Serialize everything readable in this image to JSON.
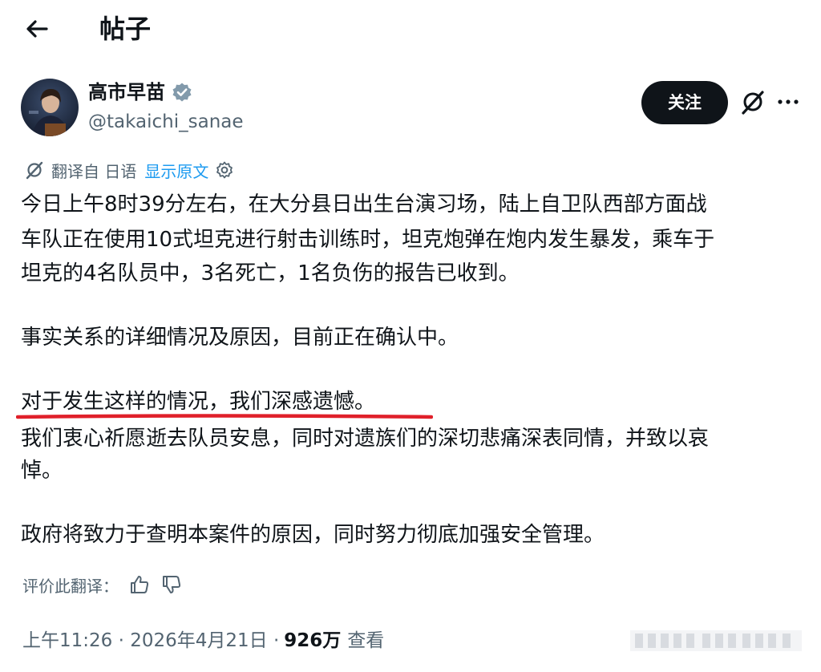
{
  "header": {
    "title": "帖子"
  },
  "author": {
    "display_name": "高市早苗",
    "handle": "@takaichi_sanae"
  },
  "actions": {
    "follow_label": "关注"
  },
  "translation": {
    "translated_from": "翻译自 日语",
    "show_original": "显示原文"
  },
  "post": {
    "lines": [
      "今日上午8时39分左右，在大分县日出生台演习场，陆上自卫队西部方面战",
      "车队正在使用10式坦克进行射击训练时，坦克炮弹在炮内发生暴发，乘车于",
      "坦克的4名队员中，3名死亡，1名负伤的报告已收到。",
      "事实关系的详细情况及原因，目前正在确认中。",
      "对于发生这样的情况，我们深感遗憾。",
      "我们衷心祈愿逝去队员安息，同时对遗族们的深切悲痛深表同情，并致以哀",
      "悼。",
      "政府将致力于查明本案件的原因，同时努力彻底加强安全管理。"
    ]
  },
  "rate_translation": {
    "label": "评价此翻译："
  },
  "meta": {
    "time_date": "上午11:26 · 2026年4月21日 ·",
    "views_count": "926万",
    "views_label": "查看"
  },
  "colors": {
    "text": "#0f1419",
    "muted": "#536471",
    "link": "#1d9bf0",
    "verified": "#829aab",
    "highlight_underline": "#e0202a"
  },
  "icons": [
    "back-arrow-icon",
    "verified-icon",
    "grok-icon",
    "more-icon",
    "translate-icon",
    "settings-icon",
    "thumbs-up-icon",
    "thumbs-down-icon"
  ]
}
